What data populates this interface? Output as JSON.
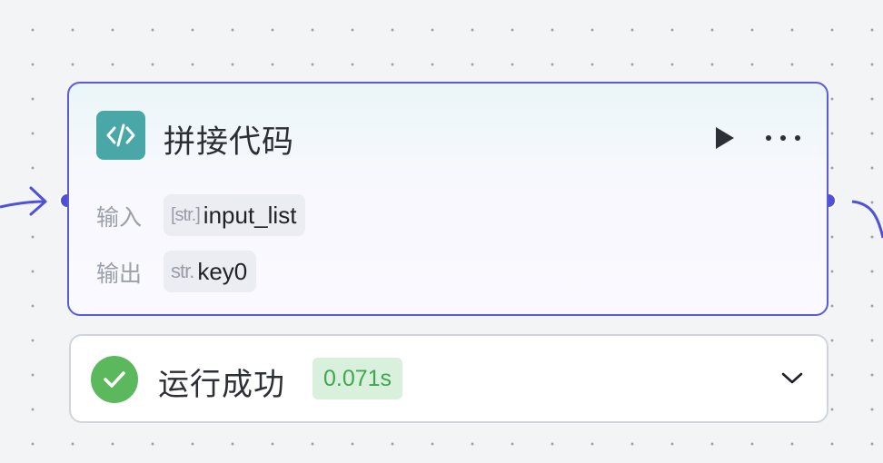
{
  "node": {
    "icon": "code-icon",
    "title": "拼接代码",
    "actions": {
      "run": "play-icon",
      "more": "more-horizontal-icon"
    },
    "input": {
      "label": "输入",
      "type_glyph": "[str.]",
      "name": "input_list"
    },
    "output": {
      "label": "输出",
      "type_glyph": "str.",
      "name": "key0"
    }
  },
  "status": {
    "icon": "check-circle-icon",
    "text": "运行成功",
    "duration": "0.071s",
    "toggle": "chevron-down-icon"
  },
  "colors": {
    "accent": "#5151d8",
    "node_icon_bg": "#4aa7a8",
    "success": "#5cb85c",
    "duration_bg": "#d9f0dc",
    "duration_text": "#3fa651"
  }
}
